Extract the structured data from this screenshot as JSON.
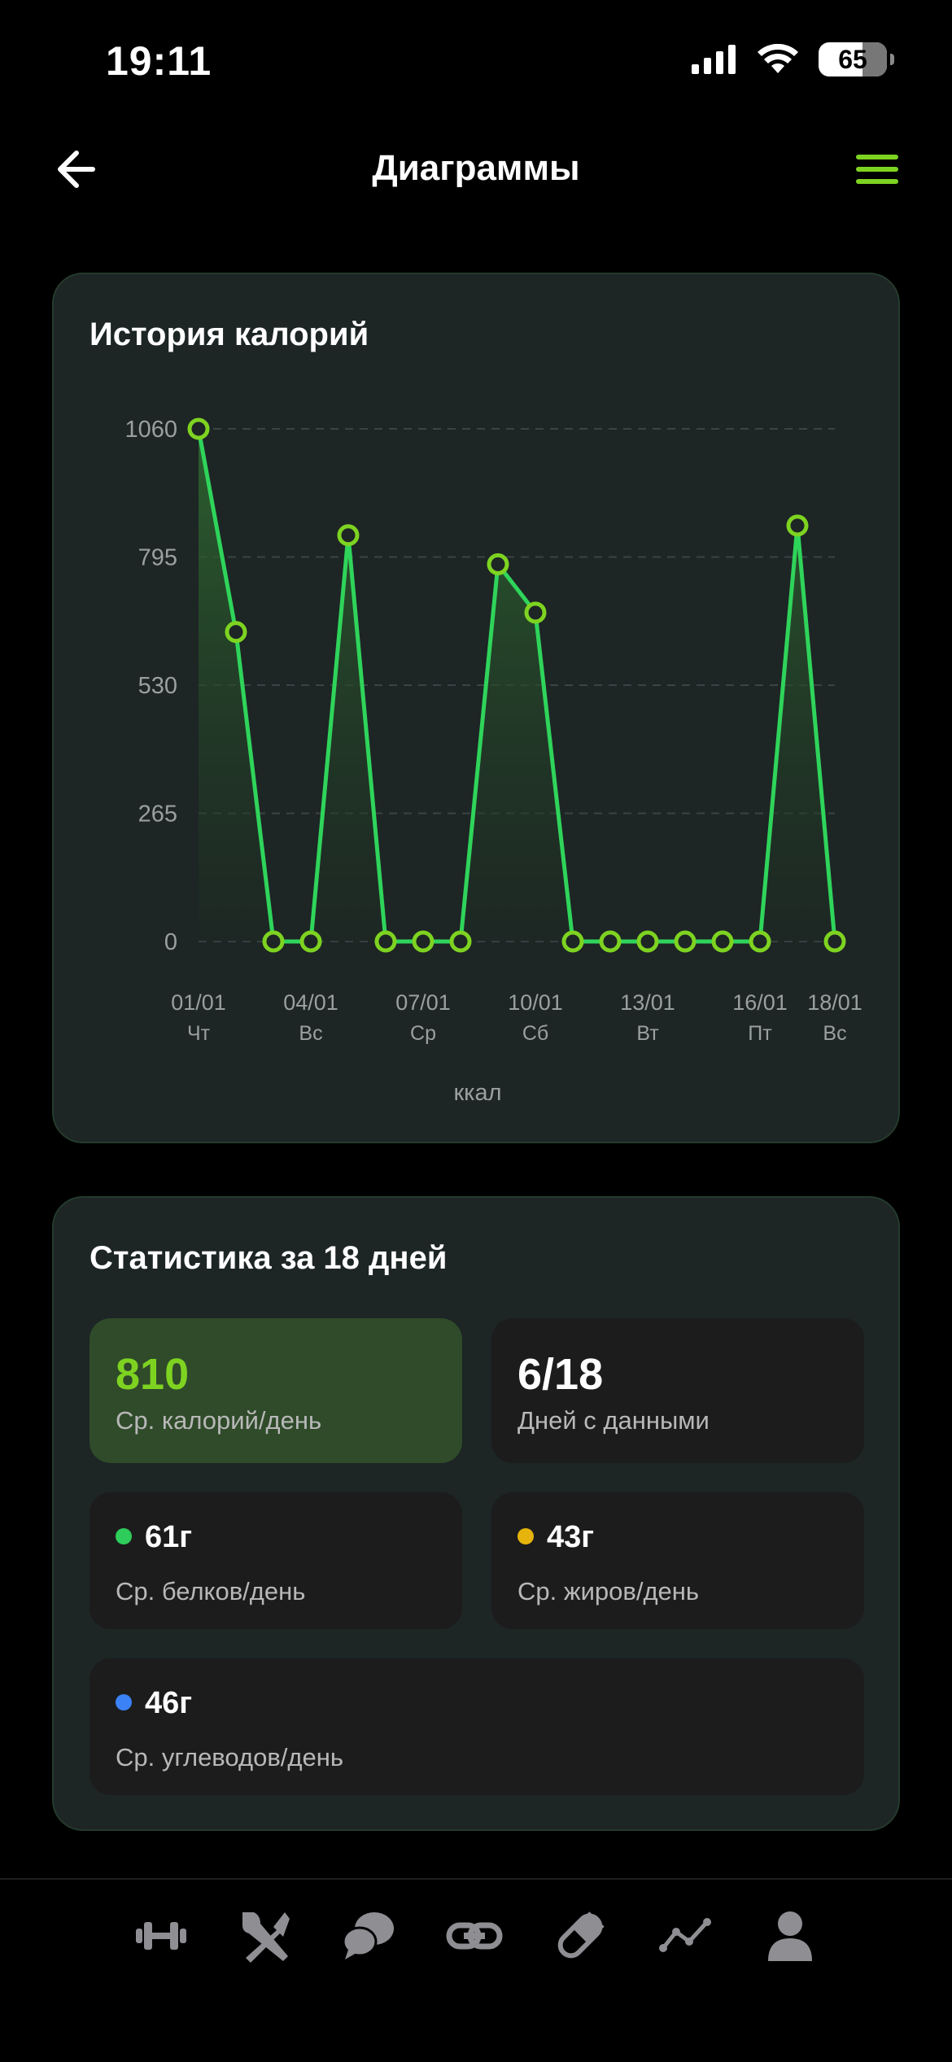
{
  "status_bar": {
    "time": "19:11",
    "battery": "65"
  },
  "header": {
    "title": "Диаграммы"
  },
  "chart_card": {
    "title": "История калорий"
  },
  "chart_data": {
    "type": "area",
    "x": [
      "01/01",
      "02/01",
      "03/01",
      "04/01",
      "05/01",
      "06/01",
      "07/01",
      "08/01",
      "09/01",
      "10/01",
      "11/01",
      "12/01",
      "13/01",
      "14/01",
      "15/01",
      "16/01",
      "17/01",
      "18/01"
    ],
    "x_tick_labels": [
      {
        "date": "01/01",
        "day": "Чт",
        "index": 0
      },
      {
        "date": "04/01",
        "day": "Вс",
        "index": 3
      },
      {
        "date": "07/01",
        "day": "Ср",
        "index": 6
      },
      {
        "date": "10/01",
        "day": "Сб",
        "index": 9
      },
      {
        "date": "13/01",
        "day": "Вт",
        "index": 12
      },
      {
        "date": "16/01",
        "day": "Пт",
        "index": 15
      },
      {
        "date": "18/01",
        "day": "Вс",
        "index": 17
      }
    ],
    "series": [
      {
        "values": [
          1060,
          640,
          0,
          0,
          840,
          0,
          0,
          0,
          780,
          680,
          0,
          0,
          0,
          0,
          0,
          0,
          860,
          0
        ]
      }
    ],
    "y_ticks": [
      0,
      265,
      530,
      795,
      1060
    ],
    "ylim": [
      0,
      1060
    ],
    "xlabel": "ккал",
    "grid": "horizontal dashed",
    "colors": {
      "line": "#2fd45a",
      "marker": "#7ed321",
      "fill": "#2a5a2c"
    }
  },
  "stats": {
    "title": "Статистика за 18 дней",
    "avg_calories": {
      "value": "810",
      "label": "Ср. калорий/день"
    },
    "days_with_data": {
      "value": "6/18",
      "label": "Дней с данными"
    },
    "protein": {
      "value": "61г",
      "label": "Ср. белков/день",
      "color": "#2ecc5a"
    },
    "fat": {
      "value": "43г",
      "label": "Ср. жиров/день",
      "color": "#e6b40c"
    },
    "carbs": {
      "value": "46г",
      "label": "Ср. углеводов/день",
      "color": "#3b82f6"
    }
  },
  "tabbar": {
    "items": [
      "dumbbell-icon",
      "fork-knife-icon",
      "chat-bubbles-icon",
      "link-icon",
      "pill-icon",
      "trend-line-icon",
      "person-icon"
    ],
    "icon_color": "#8e8e93"
  }
}
